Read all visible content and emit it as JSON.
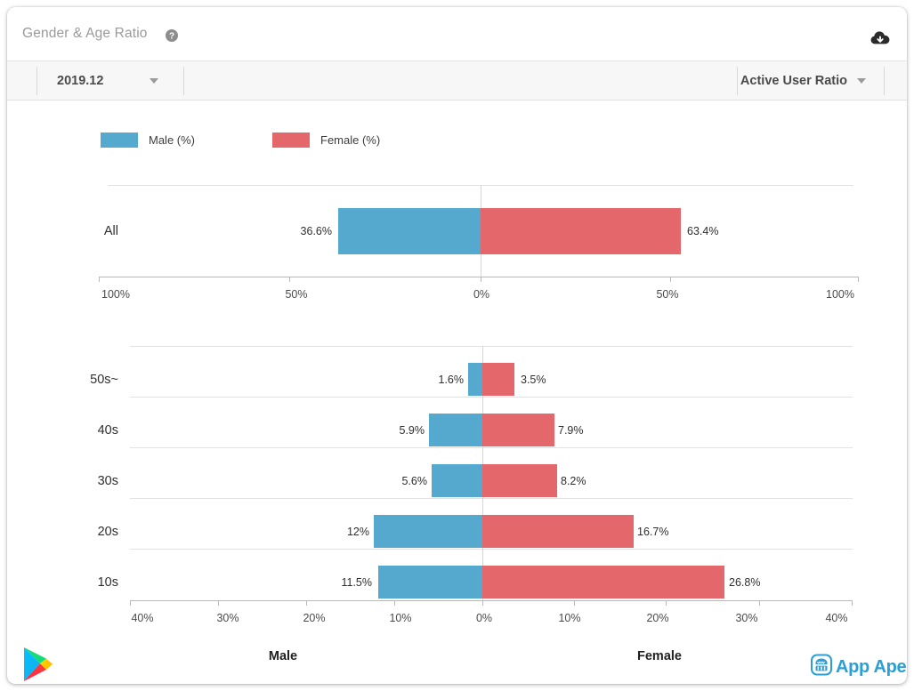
{
  "header": {
    "title": "Gender & Age Ratio",
    "help_icon": "help-circle-icon",
    "download_icon": "cloud-download-icon"
  },
  "toolbar": {
    "period_select": {
      "value": "2019.12",
      "caret": "chevron-down-icon"
    },
    "metric_select": {
      "value": "Active User Ratio",
      "caret": "chevron-down-icon"
    }
  },
  "legend": [
    {
      "label": "Male (%)",
      "color": "#55a8ce"
    },
    {
      "label": "Female (%)",
      "color": "#e4686b"
    }
  ],
  "footer": {
    "male_label": "Male",
    "female_label": "Female",
    "google_play_icon": "google-play-icon",
    "brand": "App Ape",
    "brand_color": "#2b9fd4"
  },
  "chart_data": [
    {
      "type": "bar",
      "title": "All",
      "orientation": "horizontal-diverging",
      "categories": [
        "All"
      ],
      "series": [
        {
          "name": "Male (%)",
          "color": "#55a8ce",
          "values": [
            36.6
          ]
        },
        {
          "name": "Female (%)",
          "color": "#e4686b",
          "values": [
            63.4
          ]
        }
      ],
      "labels": {
        "left": [
          "36.6%"
        ],
        "right": [
          "63.4%"
        ]
      },
      "xticks": [
        "100%",
        "50%",
        "0%",
        "50%",
        "100%"
      ],
      "xtick_values": [
        -100,
        -50,
        0,
        50,
        100
      ],
      "xlim": [
        -100,
        100
      ],
      "ylabel": "",
      "grid": true
    },
    {
      "type": "bar",
      "title": "By Age",
      "orientation": "horizontal-diverging",
      "categories": [
        "50s~",
        "40s",
        "30s",
        "20s",
        "10s"
      ],
      "series": [
        {
          "name": "Male (%)",
          "color": "#55a8ce",
          "values": [
            1.6,
            5.9,
            5.6,
            12.0,
            11.5
          ]
        },
        {
          "name": "Female (%)",
          "color": "#e4686b",
          "values": [
            3.5,
            7.9,
            8.2,
            16.7,
            26.8
          ]
        }
      ],
      "labels": {
        "left": [
          "1.6%",
          "5.9%",
          "5.6%",
          "12%",
          "11.5%"
        ],
        "right": [
          "3.5%",
          "7.9%",
          "8.2%",
          "16.7%",
          "26.8%"
        ]
      },
      "xticks": [
        "40%",
        "30%",
        "20%",
        "10%",
        "0%",
        "10%",
        "20%",
        "30%",
        "40%"
      ],
      "xtick_values": [
        -40,
        -30,
        -20,
        -10,
        0,
        10,
        20,
        30,
        40
      ],
      "xlim": [
        -40,
        40
      ],
      "xlabel_left": "Male",
      "xlabel_right": "Female",
      "grid": true
    }
  ]
}
